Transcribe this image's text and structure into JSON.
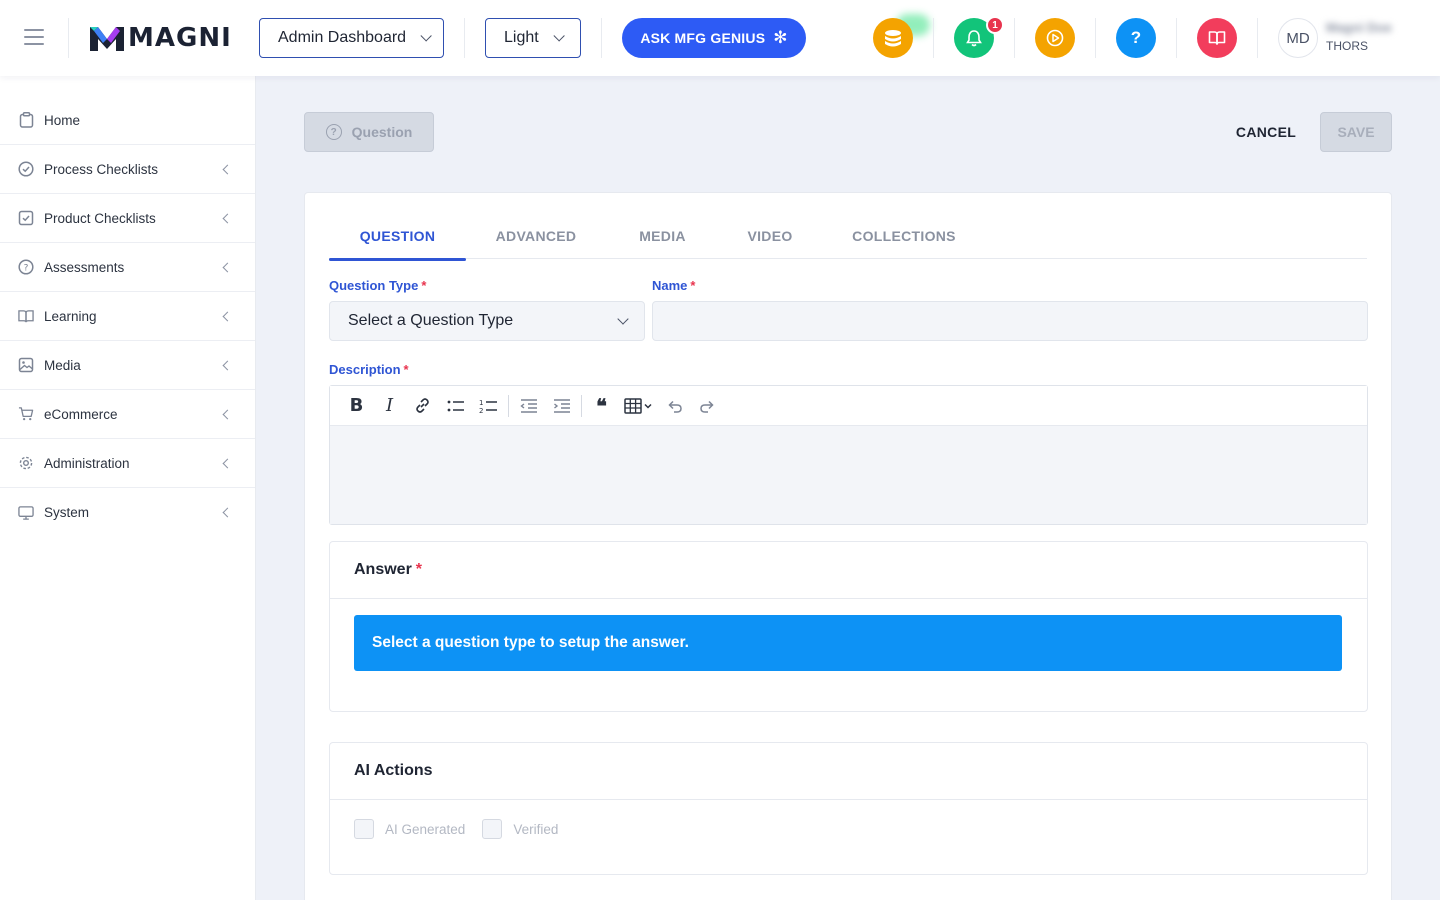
{
  "header": {
    "logo_text": "MAGNI",
    "dashboard_select": "Admin Dashboard",
    "theme_select": "Light",
    "genius_button": "ASK MFG GENIUS",
    "notification_count": "1",
    "avatar_initials": "MD",
    "user_name": "Magni Doe",
    "user_org": "THORS",
    "colors": {
      "coins": "#f4a300",
      "bell": "#12c47a",
      "play": "#f4a300",
      "help": "#0d92f5",
      "book": "#f23d5c"
    }
  },
  "sidebar": {
    "items": [
      {
        "label": "Home",
        "icon": "clipboard-icon",
        "has_chevron": false
      },
      {
        "label": "Process Checklists",
        "icon": "check-circle-icon",
        "has_chevron": true
      },
      {
        "label": "Product Checklists",
        "icon": "check-square-icon",
        "has_chevron": true
      },
      {
        "label": "Assessments",
        "icon": "question-circle-icon",
        "has_chevron": true
      },
      {
        "label": "Learning",
        "icon": "book-icon",
        "has_chevron": true
      },
      {
        "label": "Media",
        "icon": "image-icon",
        "has_chevron": true
      },
      {
        "label": "eCommerce",
        "icon": "cart-icon",
        "has_chevron": true
      },
      {
        "label": "Administration",
        "icon": "gear-icon",
        "has_chevron": true
      },
      {
        "label": "System",
        "icon": "monitor-icon",
        "has_chevron": true
      }
    ]
  },
  "actions": {
    "question_button": "Question",
    "cancel_button": "CANCEL",
    "save_button": "SAVE"
  },
  "tabs": [
    {
      "label": "QUESTION",
      "active": true
    },
    {
      "label": "ADVANCED",
      "active": false
    },
    {
      "label": "MEDIA",
      "active": false
    },
    {
      "label": "VIDEO",
      "active": false
    },
    {
      "label": "COLLECTIONS",
      "active": false
    }
  ],
  "form": {
    "question_type_label": "Question Type",
    "question_type_value": "Select a Question Type",
    "name_label": "Name",
    "name_value": "",
    "description_label": "Description",
    "required_mark": "*"
  },
  "answer": {
    "title": "Answer",
    "info": "Select a question type to setup the answer."
  },
  "ai_actions": {
    "title": "AI Actions",
    "ai_generated_label": "AI Generated",
    "verified_label": "Verified",
    "ai_generated_checked": false,
    "verified_checked": false
  }
}
